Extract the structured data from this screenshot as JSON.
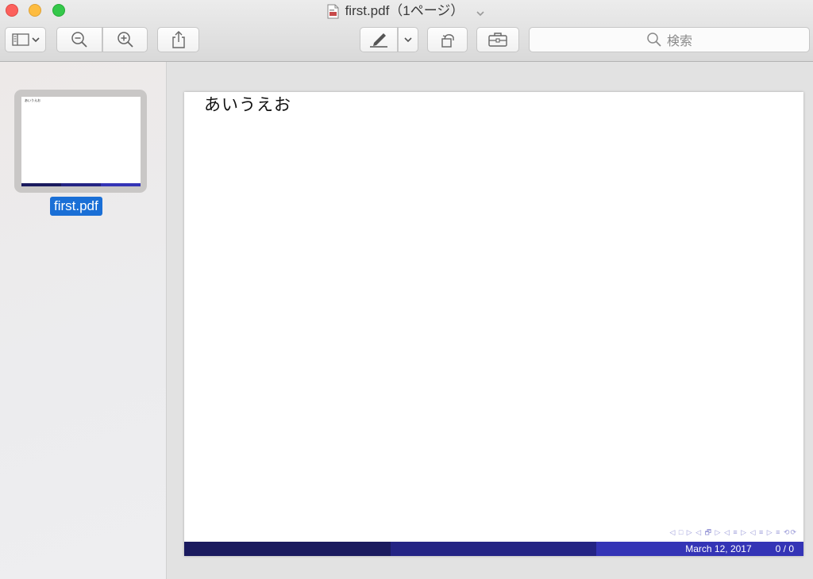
{
  "window": {
    "title": "first.pdf（1ページ）"
  },
  "toolbar": {
    "search_placeholder": "検索"
  },
  "sidebar": {
    "thumb_label": "first.pdf",
    "thumb_text": "あいうえお"
  },
  "document": {
    "text": "あいうえお",
    "nav_symbols": "◁ □ ▷ ◁ 🗗 ▷ ◁ ≡ ▷ ◁ ≡ ▷ ≡ ⟲⟳",
    "footer_date": "March 12, 2017",
    "footer_page": "0 / 0"
  },
  "colors": {
    "close": "#fc605c",
    "minimize": "#fdbc40",
    "maximize": "#34c84a",
    "selection": "#1a6fd6",
    "footer_dark": "#1a1a5e",
    "footer_mid": "#242484",
    "footer_light": "#3434b6"
  }
}
